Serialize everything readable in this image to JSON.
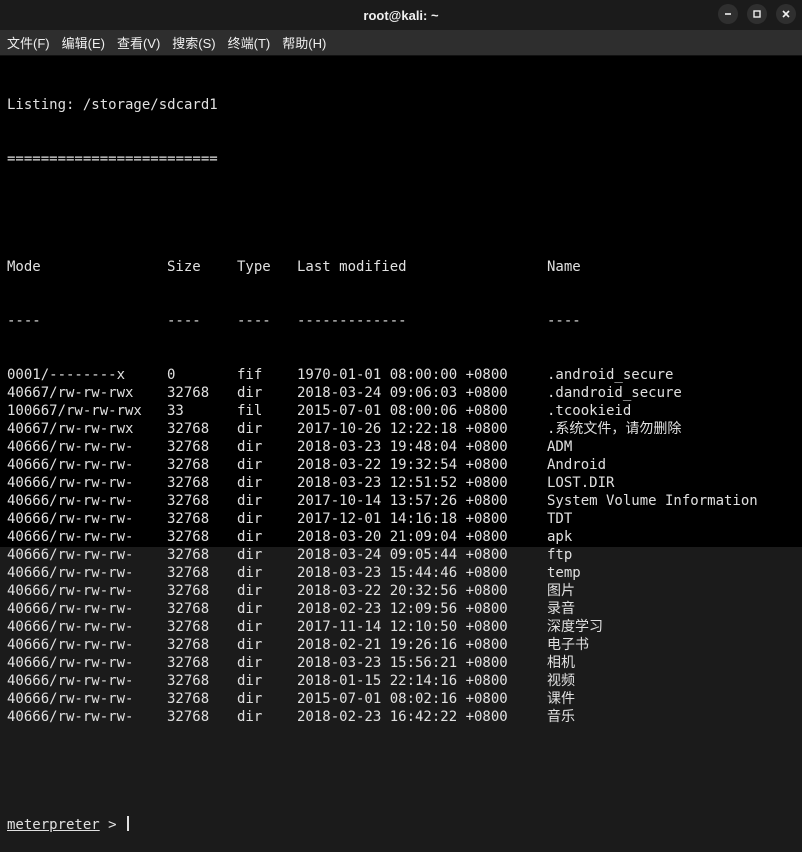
{
  "window": {
    "title": "root@kali: ~"
  },
  "menu": {
    "file": "文件(F)",
    "edit": "编辑(E)",
    "view": "查看(V)",
    "search": "搜索(S)",
    "terminal": "终端(T)",
    "help": "帮助(H)"
  },
  "listing_label": "Listing: /storage/sdcard1",
  "separator": "=========================",
  "headers": {
    "mode": "Mode",
    "size": "Size",
    "type": "Type",
    "modified": "Last modified",
    "name": "Name"
  },
  "header_dashes": {
    "mode": "----",
    "size": "----",
    "type": "----",
    "modified": "-------------",
    "name": "----"
  },
  "rows": [
    {
      "mode": "0001/--------x",
      "size": "0",
      "type": "fif",
      "date": "1970-01-01 08:00:00 +0800",
      "name": ".android_secure"
    },
    {
      "mode": "40667/rw-rw-rwx",
      "size": "32768",
      "type": "dir",
      "date": "2018-03-24 09:06:03 +0800",
      "name": ".dandroid_secure"
    },
    {
      "mode": "100667/rw-rw-rwx",
      "size": "33",
      "type": "fil",
      "date": "2015-07-01 08:00:06 +0800",
      "name": ".tcookieid"
    },
    {
      "mode": "40667/rw-rw-rwx",
      "size": "32768",
      "type": "dir",
      "date": "2017-10-26 12:22:18 +0800",
      "name": ".系统文件，请勿删除"
    },
    {
      "mode": "40666/rw-rw-rw-",
      "size": "32768",
      "type": "dir",
      "date": "2018-03-23 19:48:04 +0800",
      "name": "ADM"
    },
    {
      "mode": "40666/rw-rw-rw-",
      "size": "32768",
      "type": "dir",
      "date": "2018-03-22 19:32:54 +0800",
      "name": "Android"
    },
    {
      "mode": "40666/rw-rw-rw-",
      "size": "32768",
      "type": "dir",
      "date": "2018-03-23 12:51:52 +0800",
      "name": "LOST.DIR"
    },
    {
      "mode": "40666/rw-rw-rw-",
      "size": "32768",
      "type": "dir",
      "date": "2017-10-14 13:57:26 +0800",
      "name": "System Volume Information"
    },
    {
      "mode": "40666/rw-rw-rw-",
      "size": "32768",
      "type": "dir",
      "date": "2017-12-01 14:16:18 +0800",
      "name": "TDT"
    },
    {
      "mode": "40666/rw-rw-rw-",
      "size": "32768",
      "type": "dir",
      "date": "2018-03-20 21:09:04 +0800",
      "name": "apk"
    },
    {
      "mode": "40666/rw-rw-rw-",
      "size": "32768",
      "type": "dir",
      "date": "2018-03-24 09:05:44 +0800",
      "name": "ftp"
    },
    {
      "mode": "40666/rw-rw-rw-",
      "size": "32768",
      "type": "dir",
      "date": "2018-03-23 15:44:46 +0800",
      "name": "temp"
    },
    {
      "mode": "40666/rw-rw-rw-",
      "size": "32768",
      "type": "dir",
      "date": "2018-03-22 20:32:56 +0800",
      "name": "图片"
    },
    {
      "mode": "40666/rw-rw-rw-",
      "size": "32768",
      "type": "dir",
      "date": "2018-02-23 12:09:56 +0800",
      "name": "录音"
    },
    {
      "mode": "40666/rw-rw-rw-",
      "size": "32768",
      "type": "dir",
      "date": "2017-11-14 12:10:50 +0800",
      "name": "深度学习"
    },
    {
      "mode": "40666/rw-rw-rw-",
      "size": "32768",
      "type": "dir",
      "date": "2018-02-21 19:26:16 +0800",
      "name": "电子书"
    },
    {
      "mode": "40666/rw-rw-rw-",
      "size": "32768",
      "type": "dir",
      "date": "2018-03-23 15:56:21 +0800",
      "name": "相机"
    },
    {
      "mode": "40666/rw-rw-rw-",
      "size": "32768",
      "type": "dir",
      "date": "2018-01-15 22:14:16 +0800",
      "name": "视频"
    },
    {
      "mode": "40666/rw-rw-rw-",
      "size": "32768",
      "type": "dir",
      "date": "2015-07-01 08:02:16 +0800",
      "name": "课件"
    },
    {
      "mode": "40666/rw-rw-rw-",
      "size": "32768",
      "type": "dir",
      "date": "2018-02-23 16:42:22 +0800",
      "name": "音乐"
    }
  ],
  "prompt": {
    "host": "meterpreter",
    "marker": " > "
  }
}
